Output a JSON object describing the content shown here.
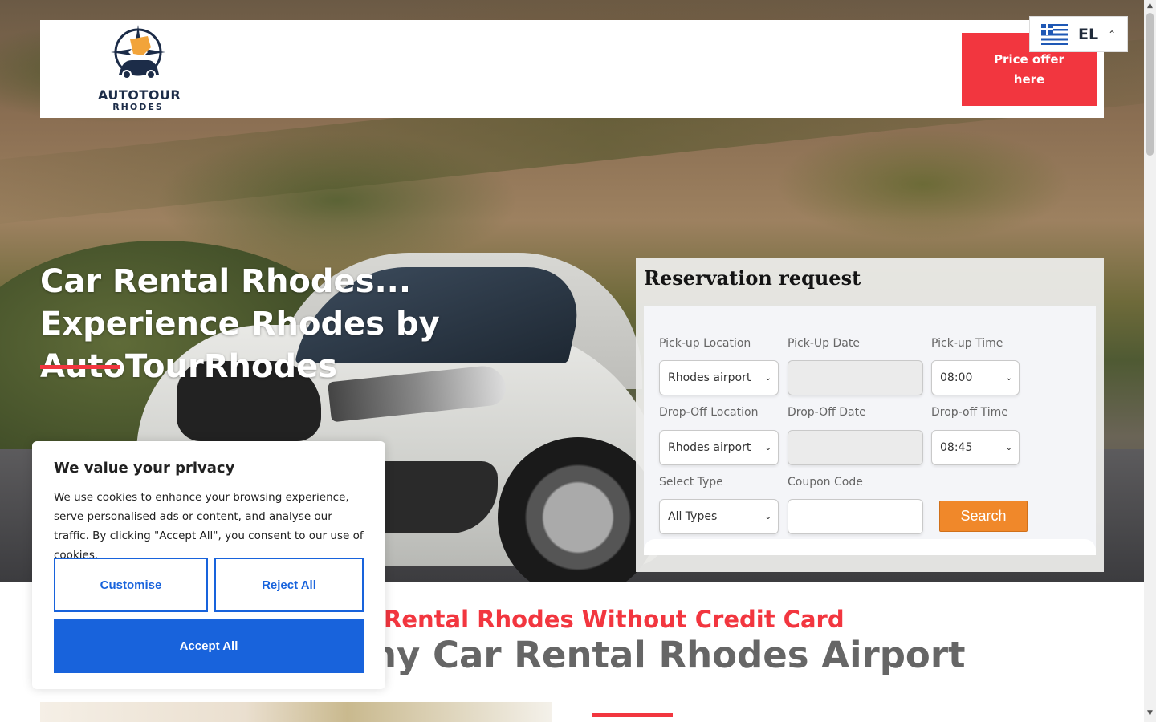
{
  "header": {
    "logo": {
      "line1": "AUTOTOUR",
      "line2": "RHODES"
    },
    "price_button": "Price offer here",
    "language": {
      "code": "EL",
      "flag_icon": "greece-flag-icon",
      "chevron_icon": "chevron-up-icon"
    }
  },
  "hero": {
    "title": "Car Rental Rhodes... Experience Rhodes by AutoTourRhodes",
    "accent_color": "#f2363f"
  },
  "reservation": {
    "title": "Reservation request",
    "pickup_location": {
      "label": "Pick-up Location",
      "value": "Rhodes airport"
    },
    "pickup_date": {
      "label": "Pick-Up Date",
      "value": ""
    },
    "pickup_time": {
      "label": "Pick-up Time",
      "value": "08:00"
    },
    "dropoff_location": {
      "label": "Drop-Off Location",
      "value": "Rhodes airport"
    },
    "dropoff_date": {
      "label": "Drop-Off Date",
      "value": ""
    },
    "dropoff_time": {
      "label": "Drop-off Time",
      "value": "08:45"
    },
    "type": {
      "label": "Select Type",
      "value": "All Types"
    },
    "coupon": {
      "label": "Coupon Code",
      "value": ""
    },
    "search_label": "Search",
    "search_color": "#f0882a"
  },
  "section": {
    "subtitle": "Rental Rhodes Without Credit Card",
    "title": "ny Car Rental Rhodes Airport"
  },
  "cookie": {
    "title": "We value your privacy",
    "text": "We use cookies to enhance your browsing experience, serve personalised ads or content, and analyse our traffic. By clicking \"Accept All\", you consent to our use of cookies.",
    "customise": "Customise",
    "reject": "Reject All",
    "accept": "Accept All",
    "accent_color": "#1863dc"
  }
}
